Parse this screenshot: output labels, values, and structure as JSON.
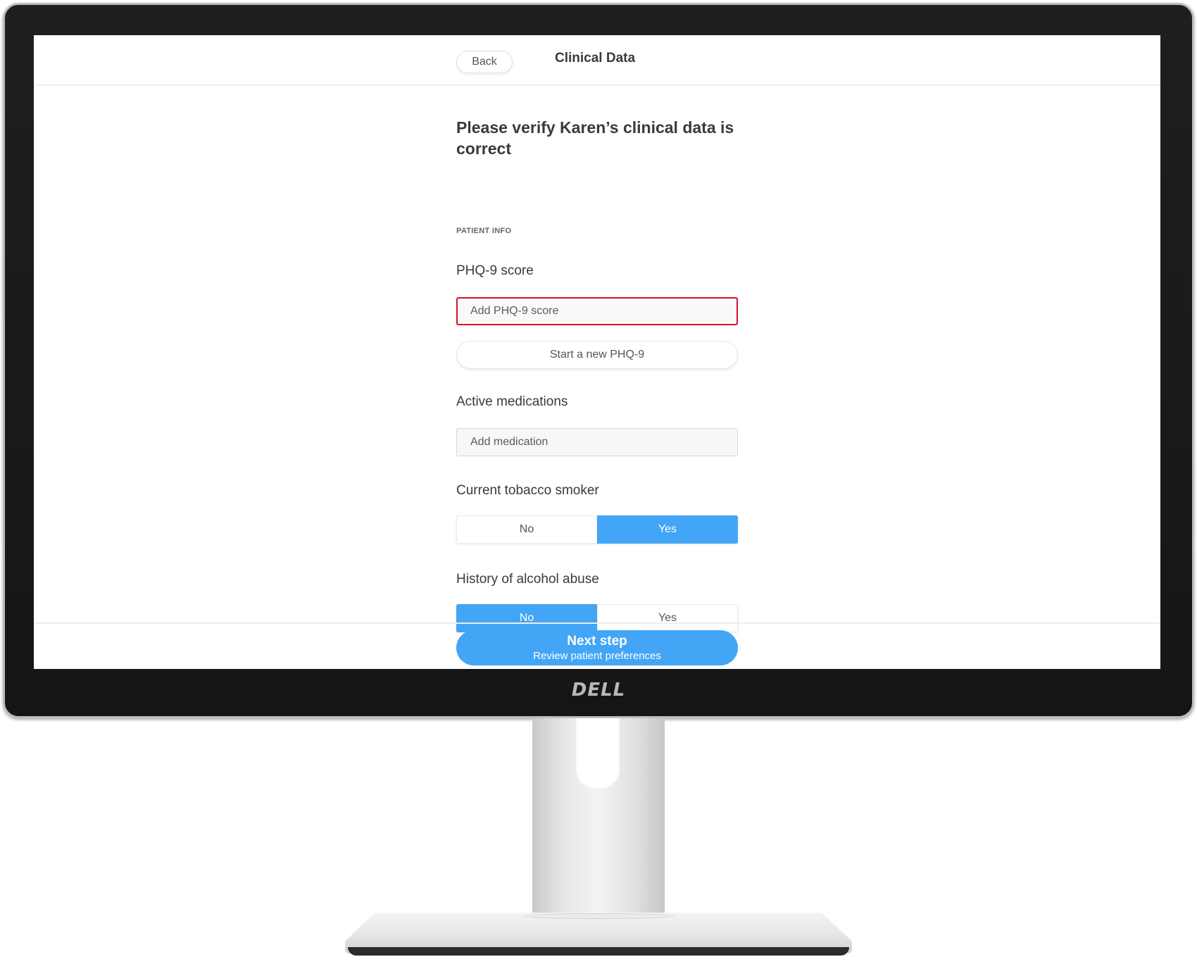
{
  "device": {
    "brand_logo": "DELL"
  },
  "header": {
    "back_label": "Back",
    "title": "Clinical Data"
  },
  "main": {
    "heading": "Please verify Karen’s clinical data is correct",
    "section_label": "PATIENT INFO",
    "phq9": {
      "label": "PHQ-9 score",
      "placeholder": "Add PHQ-9 score",
      "value": "",
      "start_button_label": "Start a new PHQ-9"
    },
    "medications": {
      "label": "Active medications",
      "placeholder": "Add medication",
      "value": ""
    },
    "tobacco": {
      "label": "Current tobacco smoker",
      "options": [
        "No",
        "Yes"
      ],
      "selected": "Yes"
    },
    "alcohol": {
      "label": "History of alcohol abuse",
      "options": [
        "No",
        "Yes"
      ],
      "selected": "No"
    }
  },
  "footer": {
    "next_title": "Next step",
    "next_subtitle": "Review patient preferences"
  },
  "colors": {
    "accent": "#42a5f5",
    "error": "#d0142a"
  }
}
